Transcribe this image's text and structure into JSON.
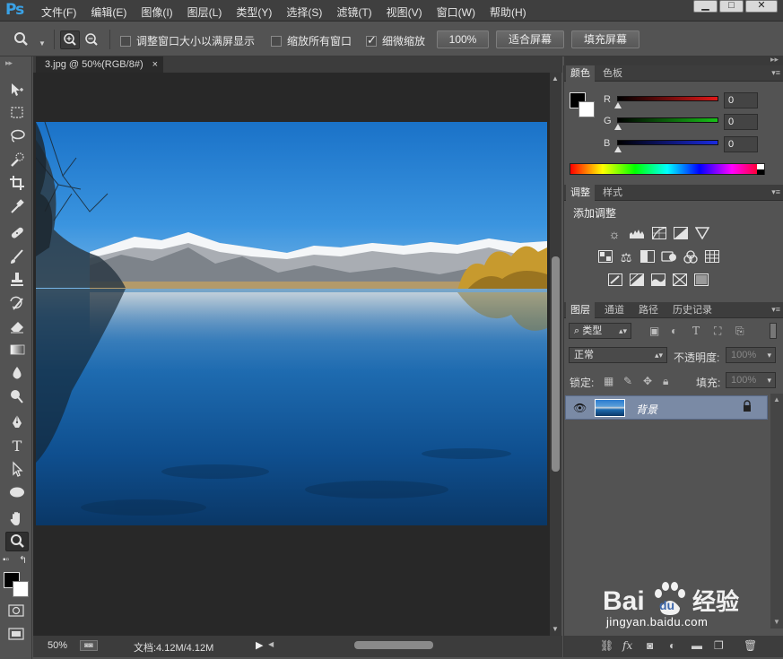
{
  "app": {
    "logo": "Ps"
  },
  "menu": [
    "文件(F)",
    "编辑(E)",
    "图像(I)",
    "图层(L)",
    "类型(Y)",
    "选择(S)",
    "滤镜(T)",
    "视图(V)",
    "窗口(W)",
    "帮助(H)"
  ],
  "window_controls": {
    "minimize": "▁",
    "maximize": "□",
    "close": "✕"
  },
  "options": {
    "resize_windows_label": "调整窗口大小以满屏显示",
    "resize_windows_checked": false,
    "zoom_all_label": "缩放所有窗口",
    "zoom_all_checked": false,
    "scrubby_zoom_label": "细微缩放",
    "scrubby_zoom_checked": true,
    "actual_pixels_btn": "100%",
    "fit_screen_btn": "适合屏幕",
    "fill_screen_btn": "填充屏幕"
  },
  "document": {
    "tab_title": "3.jpg @ 50%(RGB/8#)",
    "tab_close": "×",
    "zoom": "50%",
    "doc_size": "文档:4.12M/4.12M"
  },
  "colors": {
    "foreground": "#000000",
    "background": "#ffffff",
    "accent": "#3aa2e6",
    "layer_selected": "#7a8aa5"
  },
  "color_panel": {
    "tabs": [
      "颜色",
      "色板"
    ],
    "r_label": "R",
    "g_label": "G",
    "b_label": "B",
    "r_value": "0",
    "g_value": "0",
    "b_value": "0"
  },
  "adjustments_panel": {
    "tabs": [
      "调整",
      "样式"
    ],
    "heading": "添加调整",
    "icons": [
      "brightness-icon",
      "levels-icon",
      "curves-icon",
      "exposure-icon",
      "vibrance-icon",
      "hue-saturation-icon",
      "color-balance-icon",
      "black-white-icon",
      "photo-filter-icon",
      "channel-mixer-icon",
      "color-lookup-icon",
      "invert-icon",
      "posterize-icon",
      "threshold-icon",
      "gradient-map-icon",
      "selective-color-icon"
    ]
  },
  "layers_panel": {
    "tabs": [
      "图层",
      "通道",
      "路径",
      "历史记录"
    ],
    "filter_kind": "类型",
    "blend_mode": "正常",
    "opacity_label": "不透明度:",
    "opacity_value": "100%",
    "lock_label": "锁定:",
    "fill_label": "填充:",
    "fill_value": "100%",
    "layer_name": "背景"
  },
  "watermark": {
    "brand": "Baidu",
    "cn": "经验",
    "url": "jingyan.baidu.com"
  }
}
